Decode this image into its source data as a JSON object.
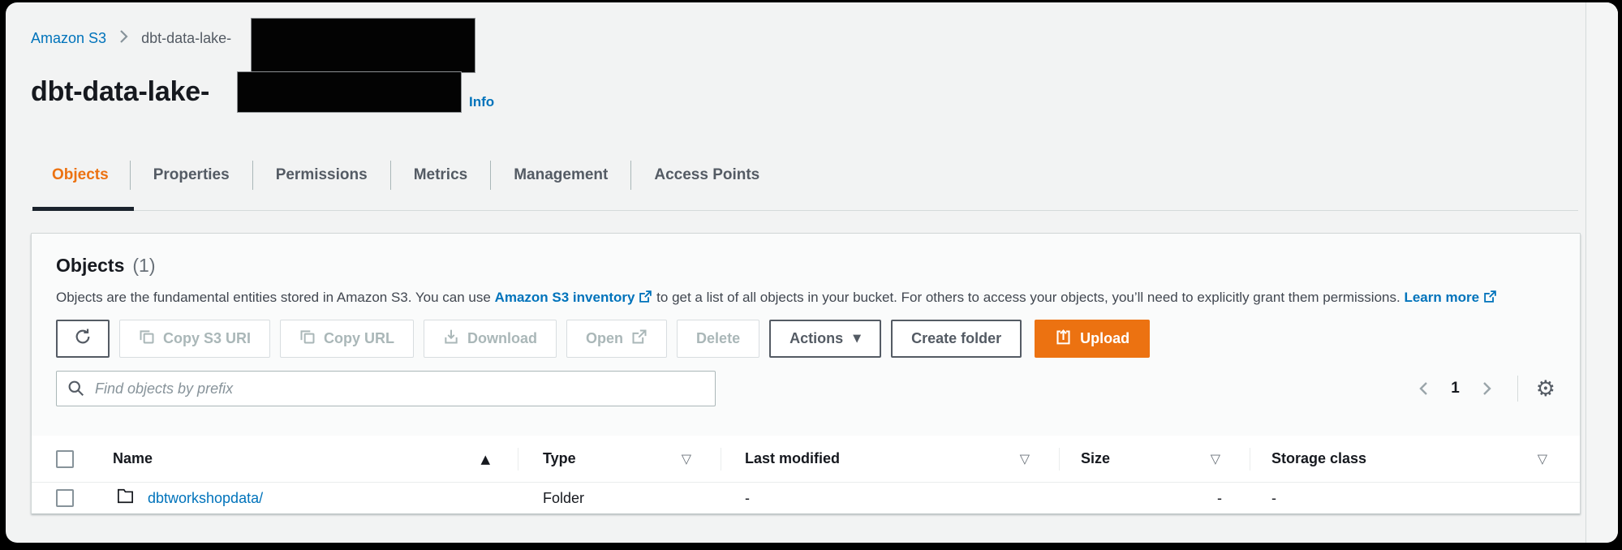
{
  "colors": {
    "accent_orange": "#ec7211",
    "link_blue": "#0073bb",
    "page_background": "#f2f3f3"
  },
  "breadcrumb": {
    "root": "Amazon S3",
    "current": "dbt-data-lake-"
  },
  "header": {
    "title": "dbt-data-lake-",
    "info_label": "Info"
  },
  "tabs": [
    {
      "label": "Objects",
      "active": true
    },
    {
      "label": "Properties",
      "active": false
    },
    {
      "label": "Permissions",
      "active": false
    },
    {
      "label": "Metrics",
      "active": false
    },
    {
      "label": "Management",
      "active": false
    },
    {
      "label": "Access Points",
      "active": false
    }
  ],
  "panel": {
    "title": "Objects",
    "count": "(1)",
    "description": {
      "part1": "Objects are the fundamental entities stored in Amazon S3. You can use ",
      "inventory_link": "Amazon S3 inventory",
      "part2": " to get a list of all objects in your bucket. For others to access your objects, you’ll need to explicitly grant them permissions. ",
      "learn_more_link": "Learn more"
    },
    "toolbar": {
      "copy_s3_uri": "Copy S3 URI",
      "copy_url": "Copy URL",
      "download": "Download",
      "open": "Open",
      "delete": "Delete",
      "actions": "Actions",
      "create_folder": "Create folder",
      "upload": "Upload"
    },
    "search": {
      "placeholder": "Find objects by prefix"
    },
    "pagination": {
      "page": "1"
    },
    "table": {
      "columns": {
        "name": "Name",
        "type": "Type",
        "last_modified": "Last modified",
        "size": "Size",
        "storage_class": "Storage class"
      },
      "rows": [
        {
          "name": "dbtworkshopdata/",
          "type": "Folder",
          "last_modified": "-",
          "size": "-",
          "storage_class": "-"
        }
      ]
    }
  },
  "icons": {
    "sort_ascending": "▲",
    "sort_filter": "▽",
    "actions_caret": "▼",
    "gear": "⚙"
  }
}
